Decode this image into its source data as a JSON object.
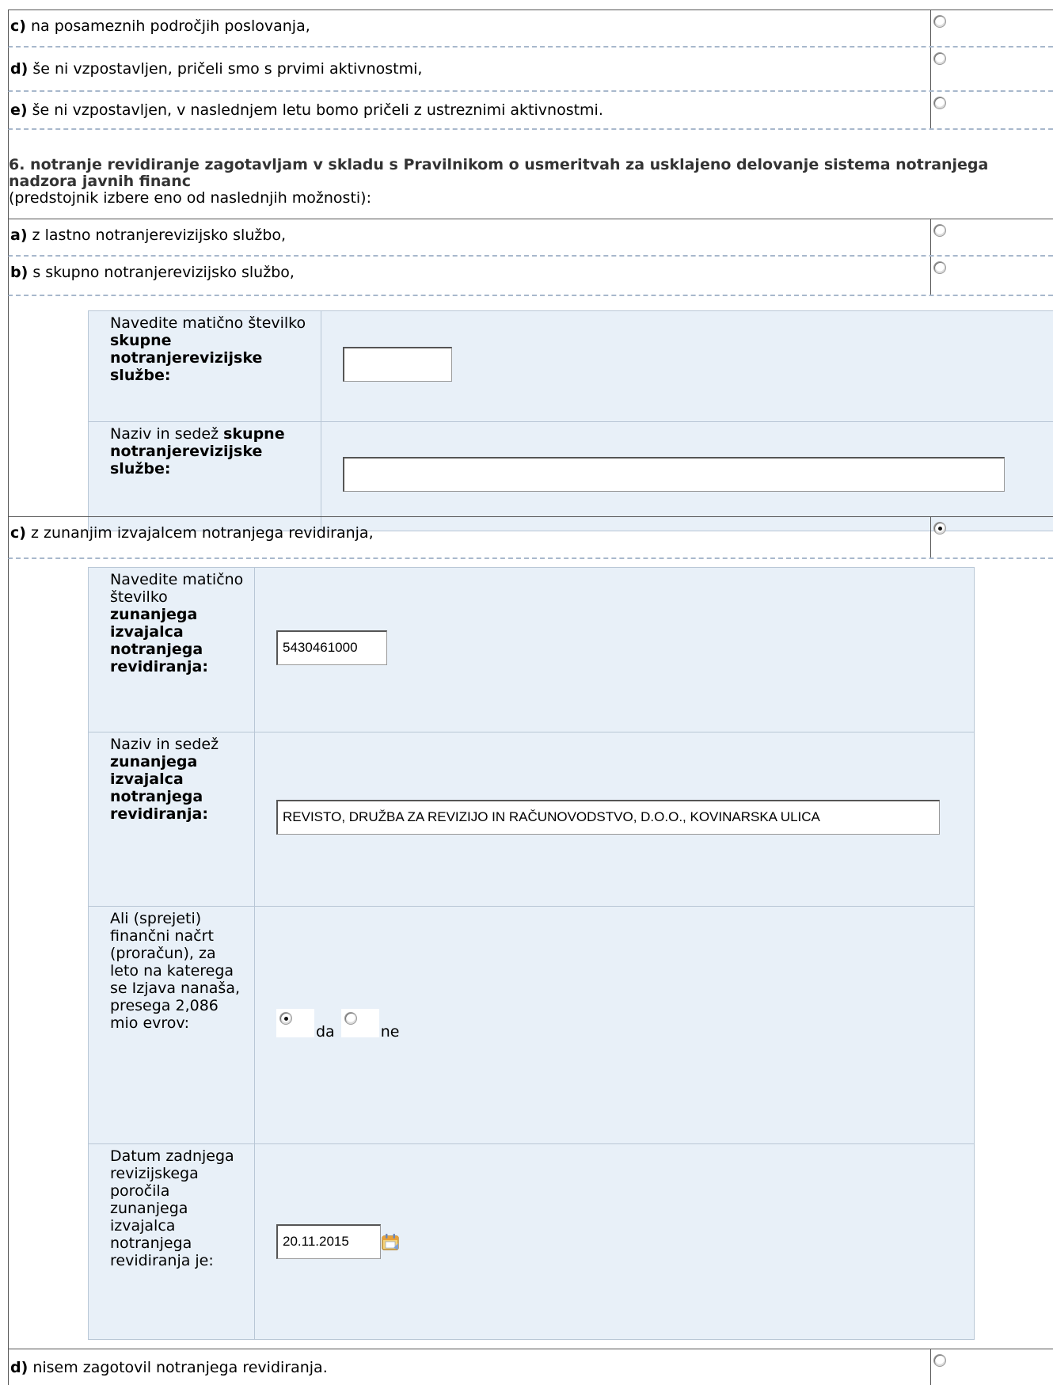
{
  "prev_options": [
    {
      "letter": "c)",
      "text": " na posameznih področjih poslovanja,",
      "checked": false
    },
    {
      "letter": "d)",
      "text": " še ni vzpostavljen, pričeli smo s prvimi aktivnostmi,",
      "checked": false
    },
    {
      "letter": "e)",
      "text": " še ni vzpostavljen, v naslednjem letu bomo pričeli z ustreznimi aktivnostmi.",
      "checked": false
    }
  ],
  "question6": {
    "title": "6. notranje revidiranje zagotavljam v skladu s Pravilnikom o usmeritvah za usklajeno delovanje sistema notranjega nadzora javnih financ",
    "subtitle": "(predstojnik izbere eno od naslednjih možnosti):",
    "options": {
      "a": {
        "letter": "a)",
        "text": " z lastno notranjerevizijsko službo,",
        "checked": false
      },
      "b": {
        "letter": "b)",
        "text": " s skupno notranjerevizijsko službo,",
        "checked": false
      },
      "c": {
        "letter": "c)",
        "text": " z zunanjim izvajalcem notranjega revidiranja,",
        "checked": true
      },
      "d": {
        "letter": "d)",
        "text": " nisem zagotovil notranjega revidiranja.",
        "checked": false
      }
    }
  },
  "skupna": {
    "maticna_label_plain": "Navedite matično številko ",
    "maticna_label_bold": "skupne notranjerevizijske službe:",
    "maticna_value": "",
    "naziv_label_plain": "Naziv in sedež ",
    "naziv_label_bold": "skupne notranjerevizijske službe:",
    "naziv_value": ""
  },
  "zunanji": {
    "maticna_label_plain": "Navedite matično številko ",
    "maticna_label_bold": "zunanjega izvajalca notranjega revidiranja:",
    "maticna_value": "5430461000",
    "naziv_label_plain": "Naziv in sedež ",
    "naziv_label_bold": "zunanjega izvajalca notranjega revidiranja:",
    "naziv_value": "REVISTO, DRUŽBA ZA REVIZIJO IN RAČUNOVODSTVO, D.O.O., KOVINARSKA ULICA",
    "budget_label": "Ali (sprejeti) finančni načrt (proračun), za leto na katerega se Izjava nanaša, presega 2,086 mio evrov:",
    "budget_yes_label": "da",
    "budget_no_label": "ne",
    "budget_value": "da",
    "date_label": "Datum zadnjega revizijskega poročila zunanjega izvajalca notranjega revidiranja je:",
    "date_value": "20.11.2015"
  },
  "icons": {
    "calendar": "calendar-icon",
    "radio": "radio-button"
  }
}
